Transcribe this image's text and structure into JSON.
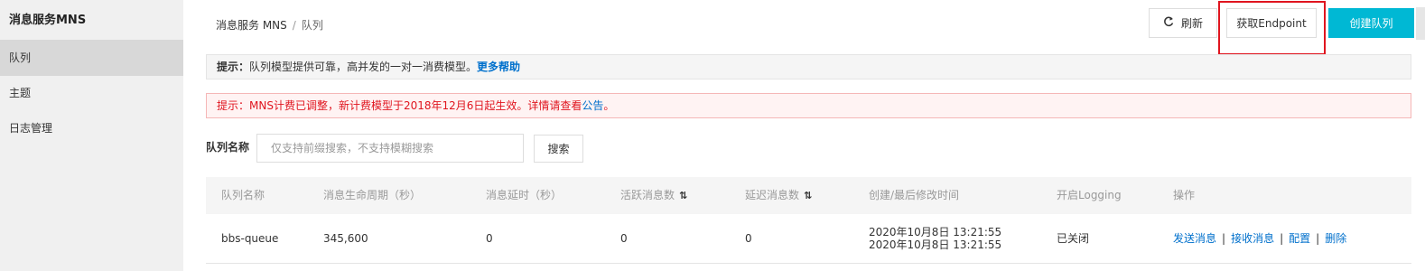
{
  "sidebar": {
    "title": "消息服务MNS",
    "items": [
      {
        "label": "队列",
        "active": true
      },
      {
        "label": "主题",
        "active": false
      },
      {
        "label": "日志管理",
        "active": false
      }
    ]
  },
  "breadcrumb": {
    "root": "消息服务 MNS",
    "sep": "/",
    "current": "队列"
  },
  "toolbar": {
    "refresh_icon": "refresh-icon",
    "refresh_label": "刷新",
    "endpoint_label": "获取Endpoint",
    "create_label": "创建队列"
  },
  "tip_info": {
    "prefix": "提示：",
    "text": "队列模型提供可靠，高并发的一对一消费模型。",
    "link": "更多帮助"
  },
  "tip_warn": {
    "text": "提示：MNS计费已调整，新计费模型于2018年12月6日起生效。详情请查看",
    "link": "公告",
    "suffix": "。"
  },
  "search": {
    "label": "队列名称",
    "placeholder": "仅支持前缀搜索，不支持模糊搜索",
    "value": "",
    "button": "搜索"
  },
  "table": {
    "columns": [
      "队列名称",
      "消息生命周期（秒）",
      "消息延时（秒）",
      "活跃消息数",
      "延迟消息数",
      "创建/最后修改时间",
      "开启Logging",
      "操作"
    ],
    "sortable_mark": "⇅",
    "rows": [
      {
        "name": "bbs-queue",
        "lifetime": "345,600",
        "delay": "0",
        "active": "0",
        "delayed": "0",
        "created": "2020年10月8日 13:21:55",
        "modified": "2020年10月8日 13:21:55",
        "logging": "已关闭",
        "ops": [
          "发送消息",
          "接收消息",
          "配置",
          "删除"
        ]
      }
    ]
  },
  "colors": {
    "accent": "#00b8d4",
    "link": "#0070cc",
    "warn": "#e0151f",
    "highlight": "#e0151f"
  }
}
